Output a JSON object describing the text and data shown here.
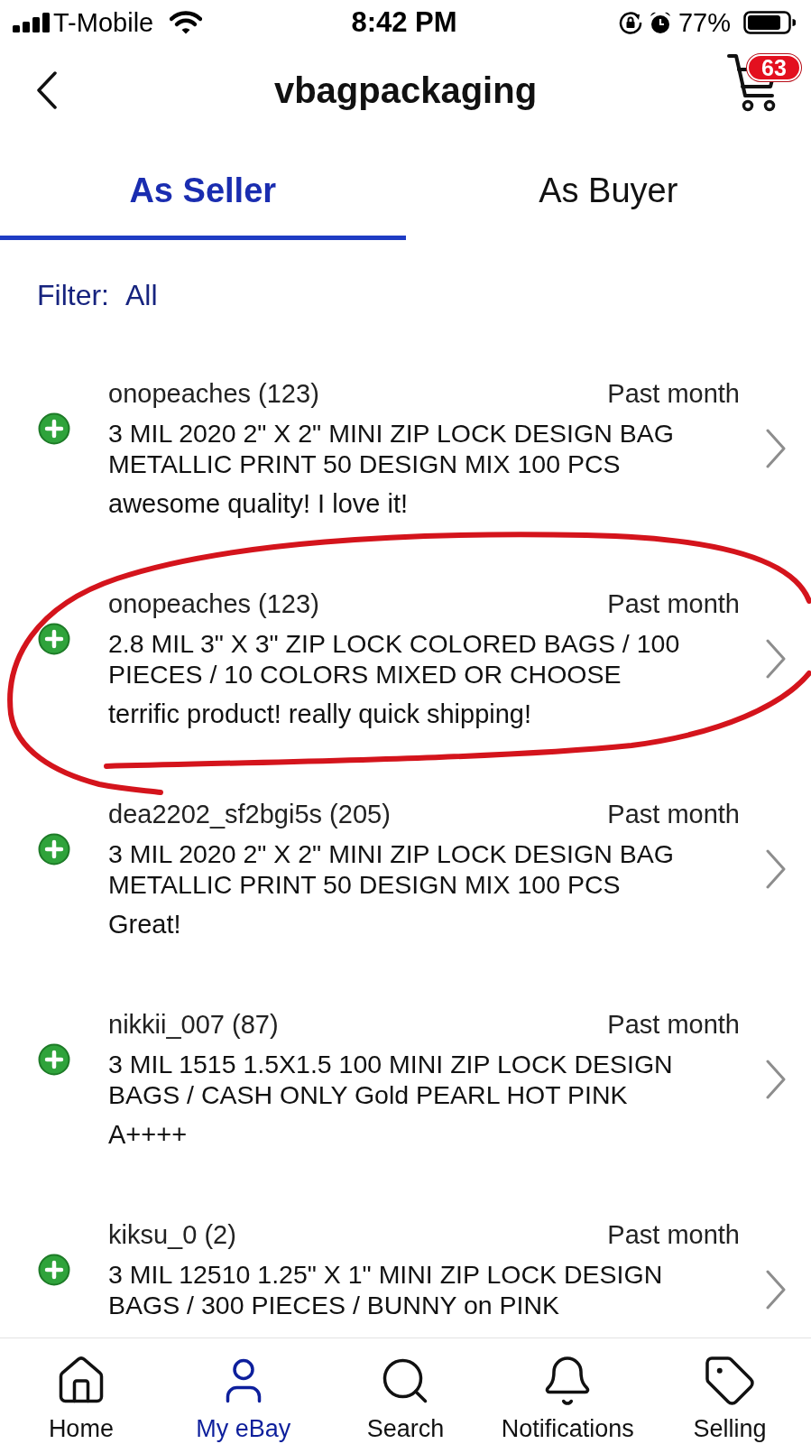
{
  "status_bar": {
    "carrier": "T-Mobile",
    "time": "8:42 PM",
    "battery": "77%"
  },
  "header": {
    "title": "vbagpackaging",
    "cart_count": "63"
  },
  "tabs": [
    {
      "label": "As Seller",
      "selected": true
    },
    {
      "label": "As Buyer",
      "selected": false
    }
  ],
  "filter": {
    "label": "Filter:",
    "value": "All"
  },
  "reviews": [
    {
      "seller": "onopeaches (123)",
      "date": "Past month",
      "title": "3 MIL 2020 2\" X 2\" MINI ZIP LOCK DESIGN BAG METALLIC PRINT 50 DESIGN MIX 100 PCS",
      "comment": "awesome quality! I love it!",
      "kind": "positive",
      "circled": false
    },
    {
      "seller": "onopeaches (123)",
      "date": "Past month",
      "title": "2.8 MIL 3\" X 3\" ZIP LOCK COLORED BAGS / 100 PIECES / 10 COLORS MIXED OR CHOOSE",
      "comment": "terrific product! really quick shipping!",
      "kind": "positive",
      "circled": true
    },
    {
      "seller": "dea2202_sf2bgi5s (205)",
      "date": "Past month",
      "title": "3 MIL 2020 2\" X 2\" MINI ZIP LOCK DESIGN BAG METALLIC PRINT 50 DESIGN MIX 100 PCS",
      "comment": "Great!",
      "kind": "positive",
      "circled": false
    },
    {
      "seller": "nikkii_007 (87)",
      "date": "Past month",
      "title": "3 MIL 1515 1.5X1.5 100 MINI ZIP LOCK DESIGN BAGS / CASH ONLY Gold PEARL HOT PINK",
      "comment": "A++++",
      "kind": "positive",
      "circled": false
    },
    {
      "seller": "kiksu_0 (2)",
      "date": "Past month",
      "title": "3 MIL 12510 1.25\" X 1\" MINI ZIP LOCK DESIGN BAGS / 300 PIECES / BUNNY on PINK",
      "kind": "positive",
      "circled": false
    }
  ],
  "bottom_nav": [
    {
      "label": "Home",
      "kind": "home",
      "selected": false
    },
    {
      "label": "My eBay",
      "kind": "account",
      "selected": true
    },
    {
      "label": "Search",
      "kind": "search",
      "selected": false
    },
    {
      "label": "Notifications",
      "kind": "notifications",
      "selected": false
    },
    {
      "label": "Selling",
      "kind": "selling",
      "selected": false
    }
  ]
}
